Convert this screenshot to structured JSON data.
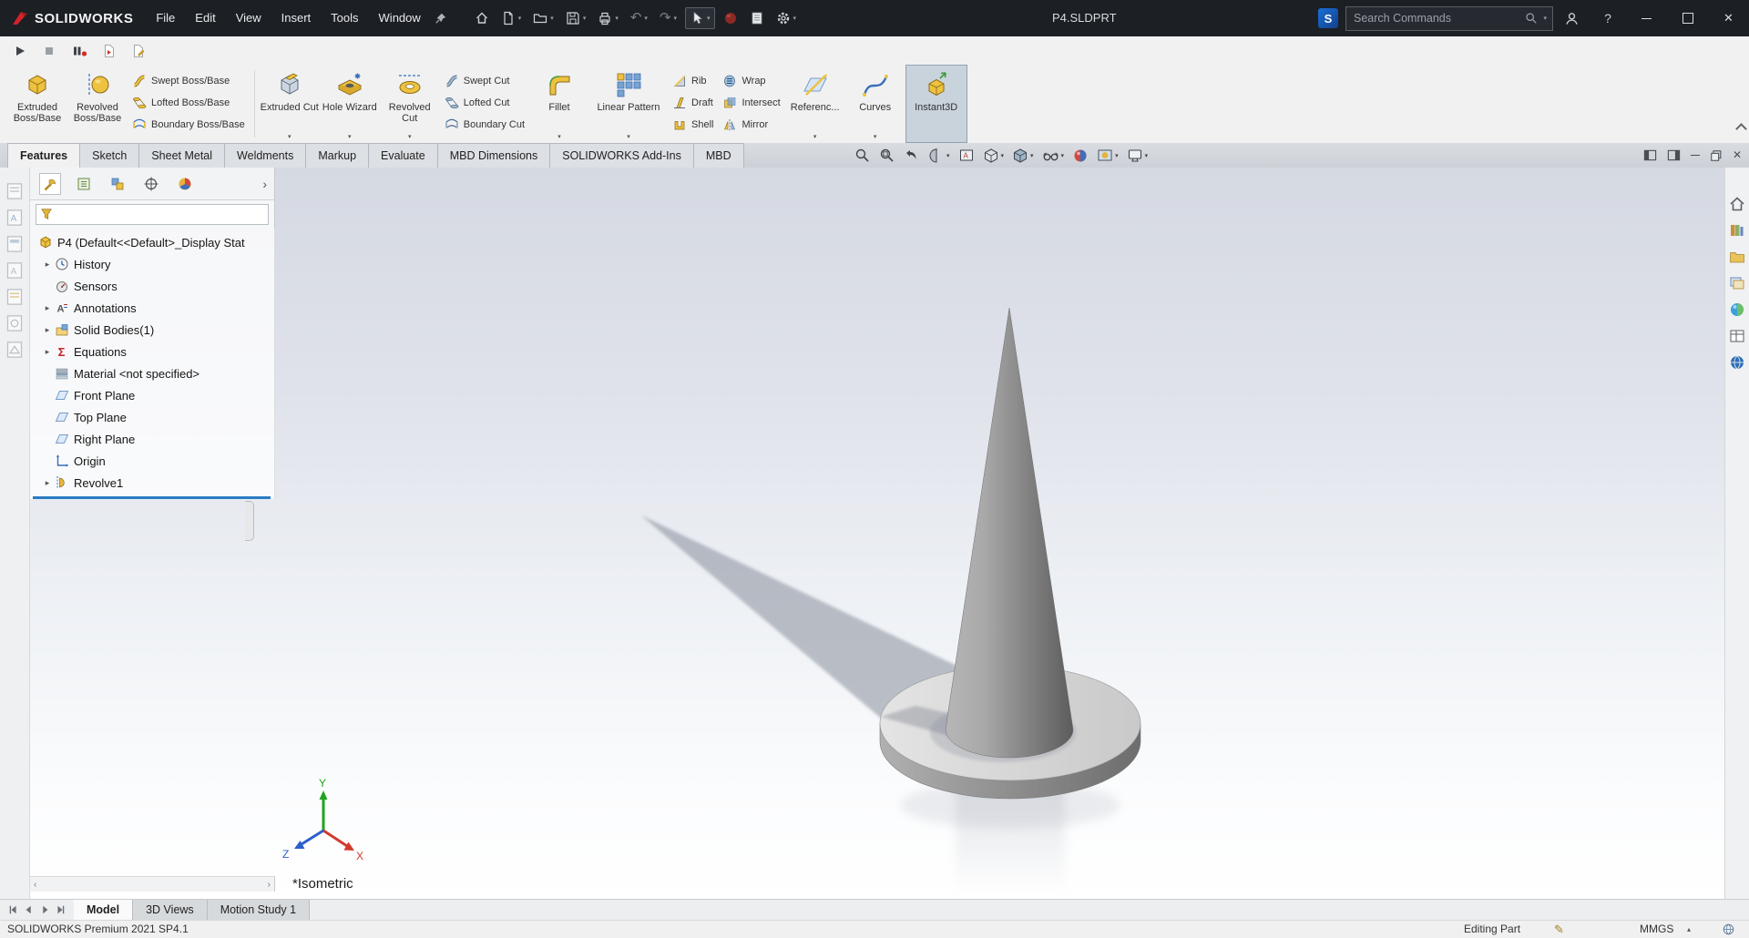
{
  "colors": {
    "titlebar_bg": "#1c1f24",
    "ribbon_bg": "#f1f1f2",
    "logo_red": "#d2232a",
    "rollback_bar_blue": "#2a7cc4",
    "instant3d_active_bg": "#c9d3dc",
    "viewport_gradient_top": "#d5d9e2",
    "viewport_gradient_bottom": "#ffffff"
  },
  "titlebar": {
    "app_name": "SOLIDWORKS",
    "menus": [
      {
        "label": "File"
      },
      {
        "label": "Edit"
      },
      {
        "label": "View"
      },
      {
        "label": "Insert"
      },
      {
        "label": "Tools"
      },
      {
        "label": "Window"
      }
    ],
    "document_title": "P4.SLDPRT",
    "search_placeholder": "Search Commands",
    "quick_toolbar_icons": [
      "home",
      "new-document",
      "open",
      "save",
      "print",
      "undo",
      "redo",
      "select",
      "marketplace",
      "file-properties",
      "options"
    ],
    "window_controls": [
      "minimize",
      "maximize",
      "close"
    ]
  },
  "macro_toolbar": {
    "icons": [
      "play-macro",
      "stop-macro",
      "record-pause-macro",
      "new-macro",
      "edit-macro"
    ]
  },
  "ribbon": {
    "buttons": {
      "extruded_boss": "Extruded Boss/Base",
      "revolved_boss": "Revolved Boss/Base",
      "swept_boss": "Swept Boss/Base",
      "lofted_boss": "Lofted Boss/Base",
      "boundary_boss": "Boundary Boss/Base",
      "extruded_cut": "Extruded Cut",
      "hole_wizard": "Hole Wizard",
      "revolved_cut": "Revolved Cut",
      "swept_cut": "Swept Cut",
      "lofted_cut": "Lofted Cut",
      "boundary_cut": "Boundary Cut",
      "fillet": "Fillet",
      "linear_pattern": "Linear Pattern",
      "rib": "Rib",
      "draft": "Draft",
      "shell": "Shell",
      "wrap": "Wrap",
      "intersect": "Intersect",
      "mirror": "Mirror",
      "reference": "Referenc...",
      "curves": "Curves",
      "instant3d": "Instant3D"
    }
  },
  "command_tabs": [
    {
      "label": "Features",
      "active": true
    },
    {
      "label": "Sketch"
    },
    {
      "label": "Sheet Metal"
    },
    {
      "label": "Weldments"
    },
    {
      "label": "Markup"
    },
    {
      "label": "Evaluate"
    },
    {
      "label": "MBD Dimensions"
    },
    {
      "label": "SOLIDWORKS Add-Ins"
    },
    {
      "label": "MBD"
    }
  ],
  "heads_up_icons": [
    "zoom-fit",
    "zoom-area",
    "previous-view",
    "section-view",
    "dynamic-annotation-views",
    "view-orientation",
    "display-style",
    "hide-show-items",
    "edit-appearance",
    "apply-scene",
    "view-settings"
  ],
  "feature_tree": {
    "root": "P4 (Default<<Default>_Display Stat",
    "items": [
      {
        "label": "History",
        "expandable": true
      },
      {
        "label": "Sensors",
        "expandable": false
      },
      {
        "label": "Annotations",
        "expandable": true
      },
      {
        "label": "Solid Bodies(1)",
        "expandable": true
      },
      {
        "label": "Equations",
        "expandable": true
      },
      {
        "label": "Material <not specified>",
        "expandable": false
      },
      {
        "label": "Front Plane",
        "expandable": false
      },
      {
        "label": "Top Plane",
        "expandable": false
      },
      {
        "label": "Right Plane",
        "expandable": false
      },
      {
        "label": "Origin",
        "expandable": false
      },
      {
        "label": "Revolve1",
        "expandable": true,
        "selected": true
      }
    ]
  },
  "viewport": {
    "view_label": "*Isometric",
    "triad": {
      "x": "X",
      "y": "Y",
      "z": "Z"
    },
    "model": "gray cone on circular disk with shadow"
  },
  "task_pane_icons": [
    "task-pane-home",
    "design-library",
    "file-explorer",
    "view-palette",
    "appearances",
    "custom-properties",
    "solidworks-resources"
  ],
  "document_tabs": [
    {
      "label": "Model",
      "active": true
    },
    {
      "label": "3D Views"
    },
    {
      "label": "Motion Study 1"
    }
  ],
  "statusbar": {
    "left_text": "SOLIDWORKS Premium 2021 SP4.1",
    "mode": "Editing Part",
    "units": "MMGS"
  }
}
